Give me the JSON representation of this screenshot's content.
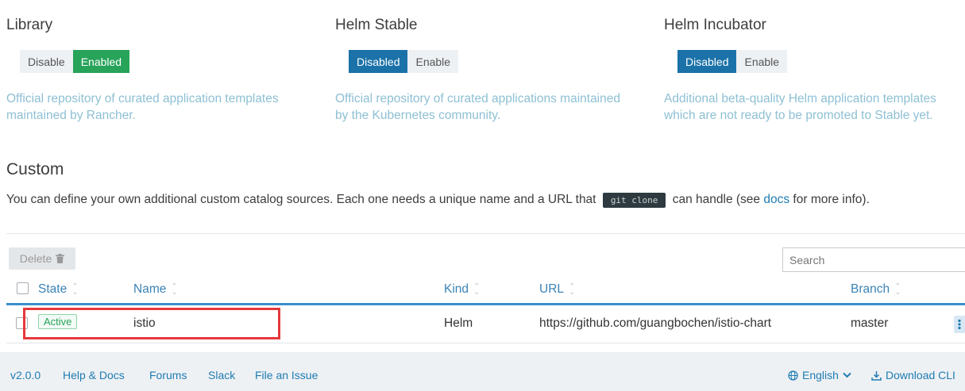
{
  "repos": [
    {
      "title": "Library",
      "options": [
        {
          "label": "Disable",
          "state": "off"
        },
        {
          "label": "Enabled",
          "state": "on-green"
        }
      ],
      "description": [
        "Official repository of curated application templates",
        "maintained by Rancher."
      ]
    },
    {
      "title": "Helm Stable",
      "options": [
        {
          "label": "Disabled",
          "state": "on-blue"
        },
        {
          "label": "Enable",
          "state": "off"
        }
      ],
      "description": [
        "Official repository of curated applications maintained",
        "by the Kubernetes community."
      ]
    },
    {
      "title": "Helm Incubator",
      "options": [
        {
          "label": "Disabled",
          "state": "on-blue"
        },
        {
          "label": "Enable",
          "state": "off"
        }
      ],
      "description": [
        "Additional beta-quality Helm application templates",
        "which are not ready to be promoted to Stable yet."
      ]
    }
  ],
  "custom": {
    "title": "Custom",
    "desc_before": "You can define your own additional custom catalog sources. Each one needs a unique name and a URL that",
    "code": "git clone",
    "desc_middle": "can handle (see",
    "docs_link": "docs",
    "desc_after": "for more info)."
  },
  "toolbar": {
    "delete_label": "Delete",
    "search_placeholder": "Search"
  },
  "table": {
    "headers": {
      "state": "State",
      "name": "Name",
      "kind": "Kind",
      "url": "URL",
      "branch": "Branch"
    },
    "rows": [
      {
        "state": "Active",
        "name": "istio",
        "kind": "Helm",
        "url": "https://github.com/guangbochen/istio-chart",
        "branch": "master"
      }
    ]
  },
  "footer": {
    "version": "v2.0.0",
    "links": [
      "Help & Docs",
      "Forums",
      "Slack",
      "File an Issue"
    ],
    "language": "English",
    "download": "Download CLI"
  },
  "colors": {
    "accent": "#1f7cb2",
    "enabled_green": "#27a35a",
    "disabled_blue": "#1b72a8",
    "highlight_red": "#e5383b"
  }
}
